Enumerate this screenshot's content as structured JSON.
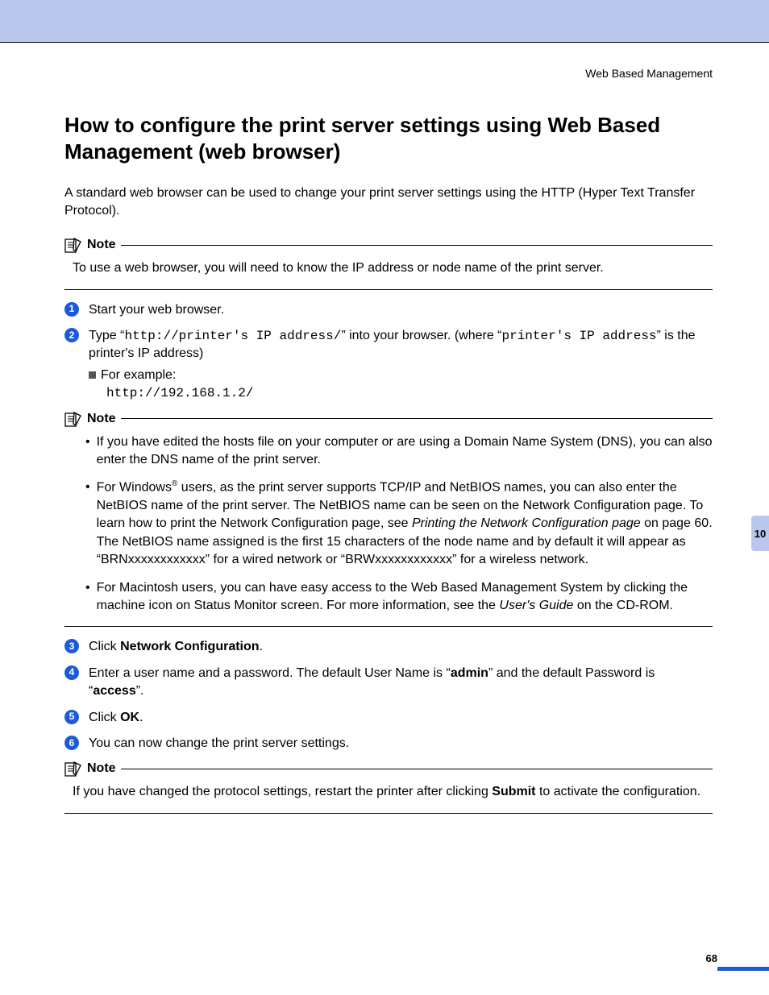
{
  "header_label": "Web Based Management",
  "title": "How to configure the print server settings using Web Based Management (web browser)",
  "intro": "A standard web browser can be used to change your print server settings using the HTTP (Hyper Text Transfer Protocol).",
  "note_label": "Note",
  "note1_body": "To use a web browser, you will need to know the IP address or node name of the print server.",
  "steps": {
    "s1": "Start your web browser.",
    "s2_a": "Type “",
    "s2_code1": "http://printer's IP address/",
    "s2_b": "” into your browser. (where “",
    "s2_code2": "printer's IP address",
    "s2_c": "” is the printer's IP address)",
    "s2_example_label": "For example:",
    "s2_example_code": "http://192.168.1.2/",
    "s3_a": "Click ",
    "s3_bold": "Network Configuration",
    "s3_b": ".",
    "s4_a": "Enter a user name and a password. The default User Name is “",
    "s4_bold1": "admin",
    "s4_b": "” and the default Password is “",
    "s4_bold2": "access",
    "s4_c": "”.",
    "s5_a": "Click ",
    "s5_bold": "OK",
    "s5_b": ".",
    "s6": "You can now change the print server settings."
  },
  "note2": {
    "b1": "If you have edited the hosts file on your computer or are using a Domain Name System (DNS), you can also enter the DNS name of the print server.",
    "b2_a": "For Windows",
    "b2_sup": "®",
    "b2_b": " users, as the print server supports TCP/IP and NetBIOS names, you can also enter the NetBIOS name of the print server. The NetBIOS name can be seen on the Network Configuration page. To learn how to print the Network Configuration page, see ",
    "b2_italic": "Printing the Network Configuration page",
    "b2_c": " on page 60. The NetBIOS name assigned is the first 15 characters of the node name and by default it will appear as “BRNxxxxxxxxxxxx” for a wired network or “BRWxxxxxxxxxxxx” for a wireless network.",
    "b3_a": "For Macintosh users, you can have easy access to the Web Based Management System by clicking the machine icon on Status Monitor screen. For more information, see the ",
    "b3_italic": "User's Guide",
    "b3_b": " on the CD-ROM."
  },
  "note3_a": "If you have changed the protocol settings, restart the printer after clicking ",
  "note3_bold": "Submit",
  "note3_b": " to activate the configuration.",
  "chapter": "10",
  "page_number": "68"
}
